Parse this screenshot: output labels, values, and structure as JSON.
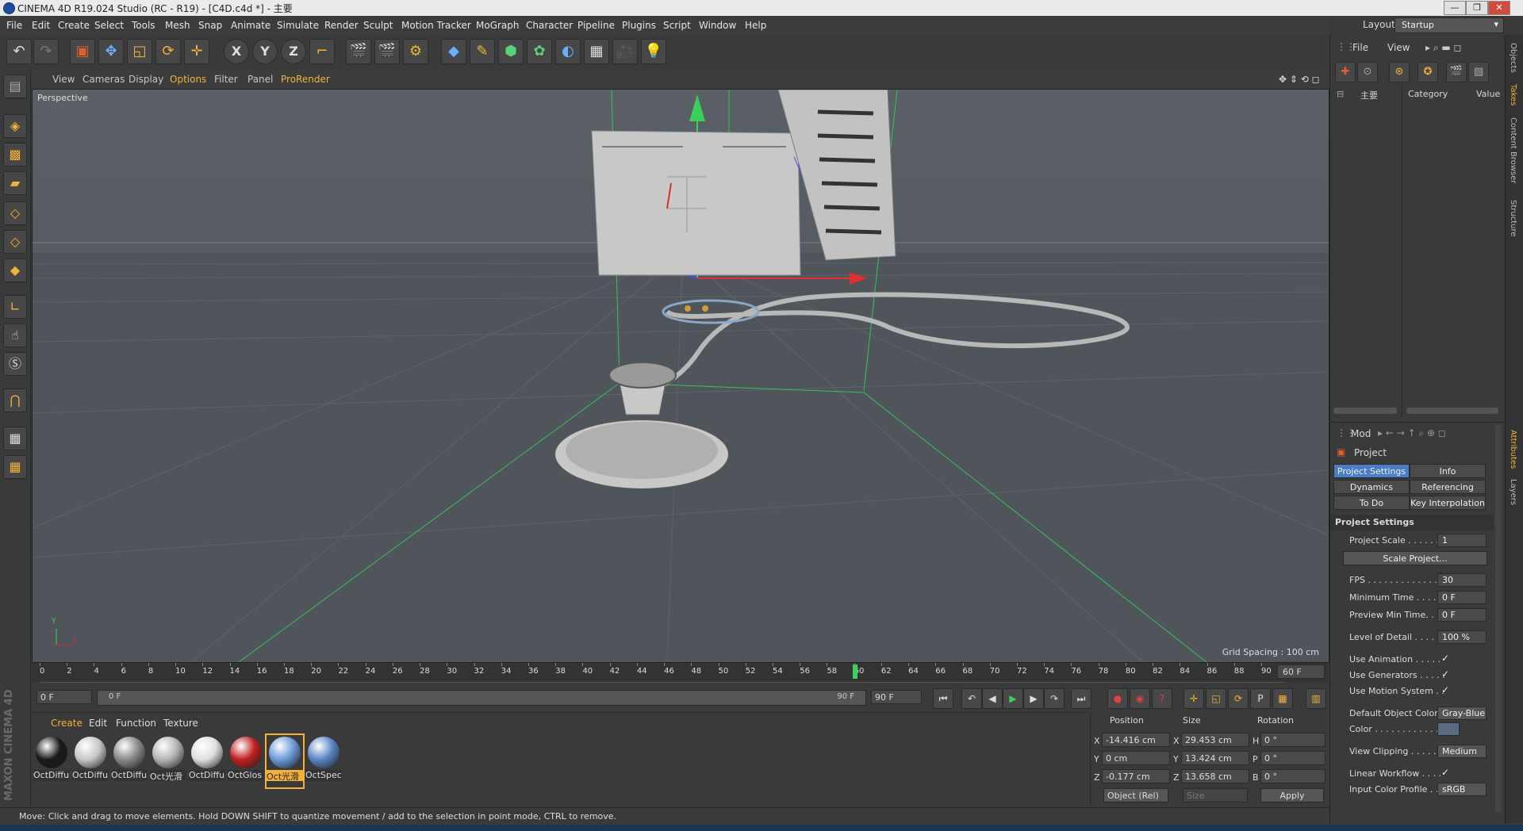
{
  "window": {
    "title": "CINEMA 4D R19.024 Studio (RC - R19) - [C4D.c4d *] - 主要",
    "controls": [
      "—",
      "❐",
      "✕"
    ]
  },
  "menubar": {
    "items": [
      "File",
      "Edit",
      "Create",
      "Select",
      "Tools",
      "Mesh",
      "Snap",
      "Animate",
      "Simulate",
      "Render",
      "Sculpt",
      "Motion Tracker",
      "MoGraph",
      "Character",
      "Pipeline",
      "Plugins",
      "Script",
      "Window",
      "Help"
    ],
    "layout_label": "Layout:",
    "layout_value": "Startup"
  },
  "viewport": {
    "menu": [
      "View",
      "Cameras",
      "Display",
      "Options",
      "Filter",
      "Panel",
      "ProRender"
    ],
    "camera_label": "Perspective",
    "grid_spacing": "Grid Spacing : 100 cm",
    "axis_y": "Y",
    "axis_x": "X"
  },
  "timeline": {
    "ticks": [
      "0",
      "2",
      "4",
      "6",
      "8",
      "10",
      "12",
      "14",
      "16",
      "18",
      "20",
      "22",
      "24",
      "26",
      "28",
      "30",
      "32",
      "34",
      "36",
      "38",
      "40",
      "42",
      "44",
      "46",
      "48",
      "50",
      "52",
      "54",
      "56",
      "58",
      "60",
      "62",
      "64",
      "66",
      "68",
      "70",
      "72",
      "74",
      "76",
      "78",
      "80",
      "82",
      "84",
      "86",
      "88",
      "90"
    ],
    "current_frame_field": "60 F",
    "start_field": "0 F",
    "range_start": "0 F",
    "range_end": "90 F",
    "end_field": "90 F",
    "current_frame": 60,
    "max_frame": 90
  },
  "materials": {
    "menu": [
      "Create",
      "Edit",
      "Function",
      "Texture"
    ],
    "items": [
      {
        "label": "OctDiffu",
        "color": "#1a1a1a"
      },
      {
        "label": "OctDiffu",
        "color": "#c8c8c8"
      },
      {
        "label": "OctDiffu",
        "color": "#8a8a8a"
      },
      {
        "label": "Oct光滑",
        "color": "#b5b5b5"
      },
      {
        "label": "OctDiffu",
        "color": "#e0e0e0"
      },
      {
        "label": "OctGlos",
        "color": "#c02020"
      },
      {
        "label": "Oct光滑",
        "color": "#6a9ad6",
        "selected": true
      },
      {
        "label": "OctSpec",
        "color": "#5a86c6"
      }
    ]
  },
  "coordinates": {
    "headers": [
      "Position",
      "Size",
      "Rotation"
    ],
    "position": [
      {
        "axis": "X",
        "value": "-14.416 cm"
      },
      {
        "axis": "Y",
        "value": "0 cm"
      },
      {
        "axis": "Z",
        "value": "-0.177 cm"
      }
    ],
    "size": [
      {
        "axis": "X",
        "value": "29.453 cm"
      },
      {
        "axis": "Y",
        "value": "13.424 cm"
      },
      {
        "axis": "Z",
        "value": "13.658 cm"
      }
    ],
    "rotation": [
      {
        "axis": "H",
        "value": "0 °"
      },
      {
        "axis": "P",
        "value": "0 °"
      },
      {
        "axis": "B",
        "value": "0 °"
      }
    ],
    "mode": "Object (Rel)",
    "size_mode": "Size",
    "apply": "Apply"
  },
  "status": "Move: Click and drag to move elements. Hold DOWN SHIFT to quantize movement / add to the selection in point mode, CTRL to remove.",
  "object_panel": {
    "menu": [
      "File",
      "View"
    ],
    "root": "主要",
    "columns": [
      "Category",
      "Value"
    ]
  },
  "attributes": {
    "menu": "Mod",
    "title": "Project",
    "tabs": [
      {
        "label": "Project Settings",
        "active": true
      },
      {
        "label": "Info",
        "active": false
      },
      {
        "label": "Dynamics",
        "active": false
      },
      {
        "label": "Referencing",
        "active": false
      },
      {
        "label": "To Do",
        "active": false
      },
      {
        "label": "Key Interpolation",
        "active": false
      }
    ],
    "section": "Project Settings",
    "project_scale": {
      "label": "Project Scale . . . . . . .",
      "value": "1"
    },
    "scale_button": "Scale Project...",
    "fps": {
      "label": "FPS . . . . . . . . . . . . . . .",
      "value": "30"
    },
    "min_time": {
      "label": "Minimum Time . . . . .",
      "value": "0 F"
    },
    "preview_min": {
      "label": "Preview Min Time. . . .",
      "value": "0 F"
    },
    "lod": {
      "label": "Level of Detail . . . . . .",
      "value": "100 %"
    },
    "use_animation": {
      "label": "Use Animation . . . . .",
      "value": "✓"
    },
    "use_generators": {
      "label": "Use Generators . . . . .",
      "value": "✓"
    },
    "use_motion": {
      "label": "Use Motion System . .",
      "value": "✓"
    },
    "default_color": {
      "label": "Default Object Color",
      "value": "Gray-Blue"
    },
    "color": {
      "label": "Color . . . . . . . . . . . ."
    },
    "view_clipping": {
      "label": "View Clipping . . . . . .",
      "value": "Medium"
    },
    "linear_workflow": {
      "label": "Linear Workflow . . . .",
      "value": "✓"
    },
    "input_profile": {
      "label": "Input Color Profile . . .",
      "value": "sRGB"
    }
  },
  "side_tabs": [
    "Objects",
    "Takes",
    "Content Browser",
    "Structure",
    "Attributes",
    "Layers"
  ],
  "brand": "MAXON CINEMA 4D"
}
